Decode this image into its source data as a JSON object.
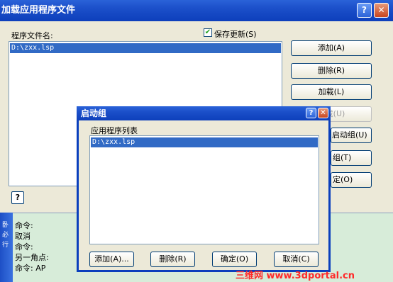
{
  "outer": {
    "title": "加载应用程序文件",
    "file_label": "程序文件名:",
    "save_updates": "保存更新(S)",
    "save_checked": "✔",
    "files": [
      "D:\\zxx.lsp"
    ],
    "buttons": {
      "add": "添加(A)",
      "delete": "删除(R)",
      "load": "加载(L)",
      "unload": "卸载(U)",
      "startup": "启动组(U)",
      "group": "组(T)",
      "ok": "定(O)"
    },
    "help": "?"
  },
  "command": {
    "side": [
      "卧",
      "必",
      "行"
    ],
    "lines": [
      "命令:",
      "取消",
      "命令:",
      "另一角点:",
      "命令: AP"
    ]
  },
  "inner": {
    "title": "启动组",
    "list_label": "应用程序列表",
    "files": [
      "D:\\zxx.lsp"
    ],
    "buttons": {
      "add": "添加(A)...",
      "delete": "删除(R)",
      "ok": "确定(O)",
      "cancel": "取消(C)"
    },
    "help": "?",
    "close": "✕"
  },
  "window_buttons": {
    "help": "?",
    "close": "✕"
  },
  "watermark": "三维网 www.3dportal.cn"
}
